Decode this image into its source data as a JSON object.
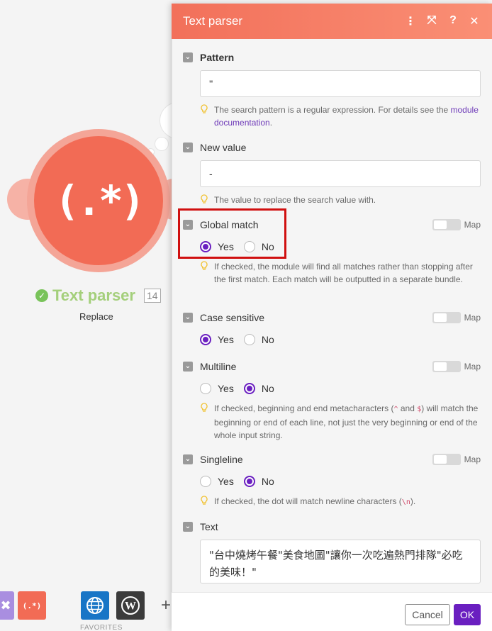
{
  "canvas": {
    "module_symbol": "(.*)",
    "module_title": "Text parser",
    "module_number": "14",
    "module_subtitle": "Replace",
    "favorites_label": "FAVORITES",
    "add_symbol": "+",
    "parser_symbol": "(.*)"
  },
  "panel": {
    "title": "Text parser",
    "icons": [
      "more-icon",
      "expand-icon",
      "help-icon",
      "close-icon"
    ],
    "icon_glyphs": {
      "more": "⋮",
      "expand": "⤧",
      "help": "?",
      "close": "✕"
    }
  },
  "fields": {
    "pattern": {
      "label": "Pattern",
      "value": "''",
      "hint_text": "The search pattern is a regular expression. For details see the",
      "hint_link": "module documentation",
      "hint_end": "."
    },
    "new_value": {
      "label": "New value",
      "value": "-",
      "hint": "The value to replace the search value with."
    },
    "global_match": {
      "label": "Global match",
      "map_label": "Map",
      "yes": "Yes",
      "no": "No",
      "selected": "Yes",
      "hint": "If checked, the module will find all matches rather than stopping after the first match. Each match will be outputted in a separate bundle."
    },
    "case_sensitive": {
      "label": "Case sensitive",
      "map_label": "Map",
      "yes": "Yes",
      "no": "No",
      "selected": "Yes"
    },
    "multiline": {
      "label": "Multiline",
      "map_label": "Map",
      "yes": "Yes",
      "no": "No",
      "selected": "No",
      "hint_a": "If checked, beginning and end metacharacters (",
      "hint_code1": "^",
      "hint_b": " and ",
      "hint_code2": "$",
      "hint_c": ") will match the beginning or end of each line, not just the very beginning or end of the whole input string."
    },
    "singleline": {
      "label": "Singleline",
      "map_label": "Map",
      "yes": "Yes",
      "no": "No",
      "selected": "No",
      "hint_a": "If checked, the dot will match newline characters (",
      "hint_code": "\\n",
      "hint_b": ")."
    },
    "text": {
      "label": "Text",
      "value": "\"台中燒烤午餐\"美食地圖\"讓你一次吃遍熱門排隊\"必吃的美味！\""
    }
  },
  "footer": {
    "cancel_label": "Cancel",
    "ok_label": "OK"
  },
  "colors": {
    "accent": "#6a1fc0",
    "header": "#f2705a",
    "module": "#f26b55",
    "highlight_box": "#d01010"
  }
}
